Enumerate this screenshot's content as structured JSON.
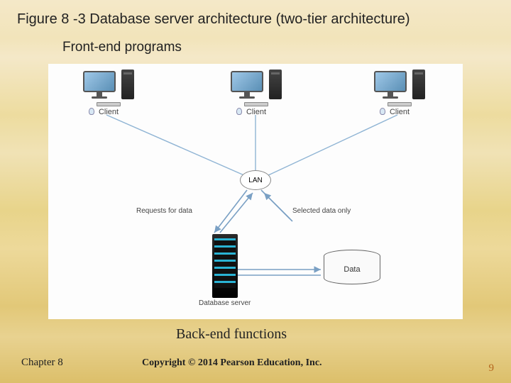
{
  "title": "Figure 8 -3 Database server architecture (two-tier architecture)",
  "frontend_label": "Front-end programs",
  "backend_label": "Back-end functions",
  "chapter": "Chapter 8",
  "copyright": "Copyright © 2014 Pearson Education, Inc.",
  "page_number": "9",
  "diagram": {
    "clients": [
      {
        "label": "Client"
      },
      {
        "label": "Client"
      },
      {
        "label": "Client"
      }
    ],
    "lan_label": "LAN",
    "server_label": "Database\nserver",
    "data_label": "Data",
    "arrow_requests": "Requests for data",
    "arrow_selected": "Selected data only"
  }
}
